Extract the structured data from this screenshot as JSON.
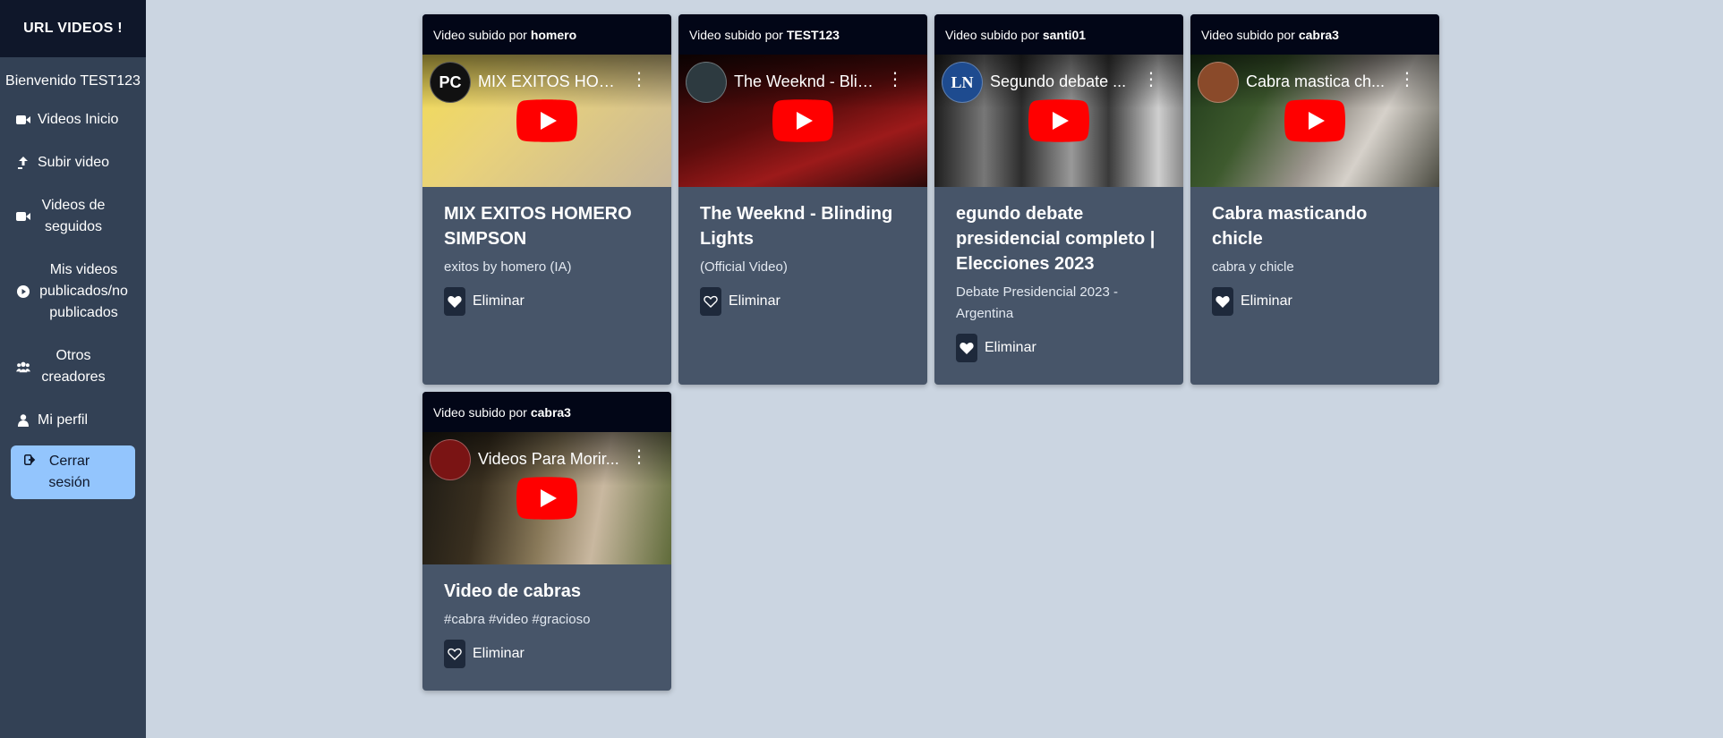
{
  "sidebar": {
    "brand": "URL VIDEOS !",
    "welcome": "Bienvenido TEST123",
    "items": [
      {
        "label": "Videos Inicio",
        "icon": "video-camera-icon"
      },
      {
        "label": "Subir video",
        "icon": "upload-arrow-icon"
      },
      {
        "label": "Videos de seguidos",
        "icon": "video-camera-icon"
      },
      {
        "label": "Mis videos publicados/no publicados",
        "icon": "play-circle-icon"
      },
      {
        "label": "Otros creadores",
        "icon": "users-icon"
      },
      {
        "label": "Mi perfil",
        "icon": "user-icon"
      }
    ],
    "logout_label": "Cerrar sesión"
  },
  "uploaded_by_prefix": "Video subido por",
  "videos": [
    {
      "uploader": "homero",
      "embed_title": "MIX EXITOS HOM...",
      "avatar_text": "PC",
      "title": "MIX EXITOS HOMERO SIMPSON",
      "description": "exitos by homero (IA)",
      "liked": true,
      "action_label": "Eliminar",
      "thumb_colors": [
        "#f5e06a",
        "#d9c9a8"
      ]
    },
    {
      "uploader": "TEST123",
      "embed_title": "The Weeknd - Blin...",
      "avatar_text": "",
      "title": "The Weeknd - Blinding Lights",
      "description": "(Official Video)",
      "liked": false,
      "action_label": "Eliminar",
      "thumb_colors": [
        "#3a0a0a",
        "#8b1414"
      ]
    },
    {
      "uploader": "santi01",
      "embed_title": "Segundo debate ...",
      "avatar_text": "LN",
      "title": "egundo debate presidencial completo | Elecciones 2023",
      "description": "Debate Presidencial 2023 - Argentina",
      "liked": true,
      "action_label": "Eliminar",
      "thumb_colors": [
        "#2b2b2b",
        "#bdbdbd"
      ]
    },
    {
      "uploader": "cabra3",
      "embed_title": "Cabra mastica ch...",
      "avatar_text": "",
      "title": "Cabra masticando chicle",
      "description": "cabra y chicle",
      "liked": true,
      "action_label": "Eliminar",
      "thumb_colors": [
        "#2f4a25",
        "#b9b4ad"
      ]
    },
    {
      "uploader": "cabra3",
      "embed_title": "Videos Para Morir...",
      "avatar_text": "",
      "title": "Video de cabras",
      "description": "#cabra #video #gracioso",
      "liked": false,
      "action_label": "Eliminar",
      "thumb_colors": [
        "#6b5a3a",
        "#c9b8a0"
      ]
    }
  ],
  "colors": {
    "page_bg": "#cbd5e1",
    "sidebar_bg": "#334155",
    "brand_bg": "#0f172a",
    "card_bg": "#475569",
    "card_head_bg": "#020617",
    "logout_bg": "#93c5fd",
    "youtube_red": "#ff0000"
  }
}
